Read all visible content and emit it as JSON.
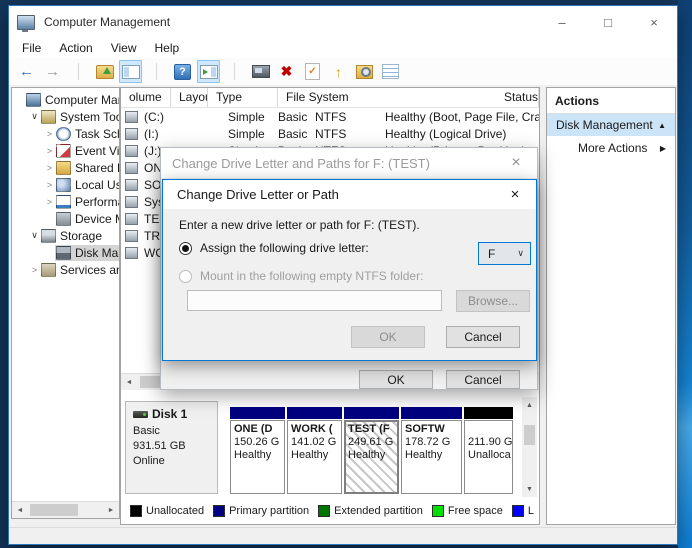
{
  "window": {
    "title": "Computer Management",
    "controls": [
      {
        "name": "minimize-button",
        "glyph": "–"
      },
      {
        "name": "maximize-button",
        "glyph": "□"
      },
      {
        "name": "close-button",
        "glyph": "×"
      }
    ]
  },
  "menu": [
    "File",
    "Action",
    "View",
    "Help"
  ],
  "toolbar": [
    {
      "name": "back-icon",
      "kind": "tb-back",
      "glyph": "←"
    },
    {
      "name": "forward-icon",
      "kind": "tb-forward",
      "glyph": "→"
    },
    {
      "name": "toolbar-separator",
      "kind": "tb-sep"
    },
    {
      "name": "up-one-level-icon",
      "kind": "tb-folder"
    },
    {
      "name": "console-tree-toggle-icon",
      "kind": "tb-panel",
      "hl": true
    },
    {
      "name": "toolbar-separator",
      "kind": "tb-sep"
    },
    {
      "name": "help-icon",
      "kind": "tb-help",
      "glyph": "?"
    },
    {
      "name": "action-pane-toggle-icon",
      "kind": "tb-panel2",
      "hl": true
    },
    {
      "name": "toolbar-separator",
      "kind": "tb-sep"
    },
    {
      "name": "remote-computer-icon",
      "kind": "tb-remote"
    },
    {
      "name": "delete-icon",
      "kind": "tb-delete",
      "glyph": "✖"
    },
    {
      "name": "check-document-icon",
      "kind": "tb-doc",
      "glyph": "✓"
    },
    {
      "name": "up-arrow-icon",
      "kind": "tb-up",
      "glyph": "↑"
    },
    {
      "name": "search-folder-icon",
      "kind": "tb-find"
    },
    {
      "name": "list-options-icon",
      "kind": "tb-list"
    }
  ],
  "tree": {
    "items": [
      {
        "label": "Computer Mana",
        "level": 0,
        "expander": "none",
        "icon": "computer-icon",
        "selected": false
      },
      {
        "label": "System Tool",
        "level": 1,
        "expander": "open",
        "icon": "system-tools-icon",
        "selected": false
      },
      {
        "label": "Task Sch",
        "level": 2,
        "expander": "closed",
        "icon": "task-scheduler-icon",
        "selected": false
      },
      {
        "label": "Event Vie",
        "level": 2,
        "expander": "closed",
        "icon": "event-viewer-icon",
        "selected": false
      },
      {
        "label": "Shared F",
        "level": 2,
        "expander": "closed",
        "icon": "shared-folders-icon",
        "selected": false
      },
      {
        "label": "Local Us",
        "level": 2,
        "expander": "closed",
        "icon": "local-users-icon",
        "selected": false
      },
      {
        "label": "Performa",
        "level": 2,
        "expander": "closed",
        "icon": "performance-icon",
        "selected": false
      },
      {
        "label": "Device M",
        "level": 2,
        "expander": "none",
        "icon": "device-manager-icon",
        "selected": false
      },
      {
        "label": "Storage",
        "level": 1,
        "expander": "open",
        "icon": "storage-icon",
        "selected": false
      },
      {
        "label": "Disk Mar",
        "level": 2,
        "expander": "none",
        "icon": "disk-management-icon",
        "selected": true
      },
      {
        "label": "Services and",
        "level": 1,
        "expander": "closed",
        "icon": "services-icon",
        "selected": false
      }
    ]
  },
  "volume_list": {
    "columns": [
      "olume",
      "Layout",
      "Type",
      "File System",
      "Status"
    ],
    "rows": [
      {
        "name": "(C:)",
        "layout": "Simple",
        "type": "Basic",
        "fs": "NTFS",
        "status": "Healthy (Boot, Page File, Cras"
      },
      {
        "name": "(I:)",
        "layout": "Simple",
        "type": "Basic",
        "fs": "NTFS",
        "status": "Healthy (Logical Drive)"
      },
      {
        "name": "(J:)",
        "layout": "Simple",
        "type": "Basic",
        "fs": "NTFS",
        "status": "Healthy (Primary Partition)"
      },
      {
        "name": "ONE ("
      },
      {
        "name": "SOFT"
      },
      {
        "name": "Syste"
      },
      {
        "name": "TEST"
      },
      {
        "name": "TRAC"
      },
      {
        "name": "WOR"
      }
    ]
  },
  "actions_panel": {
    "header": "Actions",
    "group": "Disk Management",
    "group_arrow": "▲",
    "more": "More Actions",
    "more_arrow": "▶"
  },
  "dialogs": {
    "outer": {
      "title": "Change Drive Letter and Paths for F: (TEST)",
      "close": "×",
      "ok": "OK",
      "cancel": "Cancel"
    },
    "inner": {
      "title": "Change Drive Letter or Path",
      "close": "×",
      "prompt": "Enter a new drive letter or path for F: (TEST).",
      "assign_label": "Assign the following drive letter:",
      "drive_letter": "F",
      "dropdown_chevron": "∨",
      "mount_label": "Mount in the following empty NTFS folder:",
      "mount_value": "",
      "browse": "Browse...",
      "ok": "OK",
      "cancel": "Cancel"
    }
  },
  "disk_view": {
    "disk": {
      "name": "Disk 1",
      "type": "Basic",
      "size": "931.51 GB",
      "status": "Online"
    },
    "partitions": [
      {
        "name": "ONE (D",
        "size": "150.26 G",
        "status": "Healthy",
        "bar_color": "#000080",
        "selected": false
      },
      {
        "name": "WORK (",
        "size": "141.02 G",
        "status": "Healthy",
        "bar_color": "#000080",
        "selected": false
      },
      {
        "name": "TEST (F",
        "size": "249.61 G",
        "status": "Healthy",
        "bar_color": "#000080",
        "selected": true
      },
      {
        "name": "SOFTW",
        "size": "178.72 G",
        "status": "Healthy",
        "bar_color": "#000080",
        "selected": false
      },
      {
        "name": "",
        "size": "211.90 G",
        "status": "Unalloca",
        "bar_color": "#000000",
        "selected": false
      }
    ]
  },
  "legend": [
    {
      "label": "Unallocated",
      "color": "#000000"
    },
    {
      "label": "Primary partition",
      "color": "#000080"
    },
    {
      "label": "Extended partition",
      "color": "#007500"
    },
    {
      "label": "Free space",
      "color": "#00e000"
    },
    {
      "label": "L",
      "color": "#0000ff"
    }
  ],
  "scrollbars": {
    "left": "◄",
    "right": "►",
    "up": "▲",
    "down": "▼"
  },
  "colors": {
    "accent": "#0078d7",
    "primary_partition": "#000080",
    "unallocated": "#000000",
    "actions_selection": "#cce4f7",
    "tree_selection": "#d4d4d4"
  }
}
